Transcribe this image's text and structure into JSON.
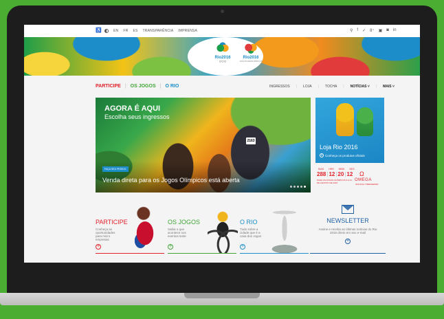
{
  "utilbar": {
    "langs": [
      "EN",
      "FR",
      "ES"
    ],
    "links": [
      "TRANSPARÊNCIA",
      "IMPRENSA"
    ],
    "social_icons": [
      "search-icon",
      "facebook-icon",
      "twitter-icon",
      "google-plus-icon",
      "youtube-icon",
      "instagram-icon",
      "linkedin-icon"
    ],
    "social_glyphs": [
      "⚲",
      "f",
      "✓",
      "8⁺",
      "▣",
      "◙",
      "in"
    ]
  },
  "banner": {
    "olympic_logo": "Rio2016",
    "paralympic_logo": "Rio2016",
    "paralympic_sub": "JOGOS PARALÍMPICOS"
  },
  "mainnav": {
    "left": [
      "PARTICIPE",
      "OS JOGOS",
      "O RIO"
    ],
    "right": [
      "INGRESSOS",
      "LOJA",
      "TOCHA",
      "NOTÍCIAS ˅",
      "MAIS ˅"
    ]
  },
  "hero": {
    "title": "AGORA É AQUI",
    "subtitle": "Escolha seus ingressos",
    "badge": "FAÇA SEU PEDIDO",
    "caption": "Venda direta para os Jogos Olímpicos está aberta",
    "bib": "2163"
  },
  "store": {
    "title": "Loja Rio 2016",
    "link": "Conheça os produtos oficiais"
  },
  "countdown": {
    "labels": [
      "DIAS",
      "HRS",
      "MINS",
      "SEG"
    ],
    "values": [
      "288",
      "12",
      "20",
      "12"
    ],
    "note": "PARA OS JOGOS OLÍMPICOS 5 A 21 DE AGOSTO DE 2016",
    "sponsor": "OMEGA",
    "sponsor_sub": "OFFICIAL TIMEKEEPER",
    "sponsor_symbol": "Ω"
  },
  "cards": {
    "participe": {
      "title": "PARTICIPE",
      "text": "Conheça as oportunidades para micro empresas"
    },
    "jogos": {
      "title": "OS JOGOS",
      "text": "Saiba o que acontece nos eventos teste"
    },
    "rio": {
      "title": "O RIO",
      "text": "Tudo sobre a cidade que é a casa dos Jogos"
    },
    "newsletter": {
      "title": "NEWSLETTER",
      "text": "Assine e receba as últimas notícias do Rio 2016 direto em seu e-mail"
    }
  },
  "colors": {
    "participe": "#e2202a",
    "jogos": "#3fa535",
    "rio": "#1c8dc8",
    "newsletter": "#1e5fa3",
    "device_bg": "#4bad32"
  }
}
